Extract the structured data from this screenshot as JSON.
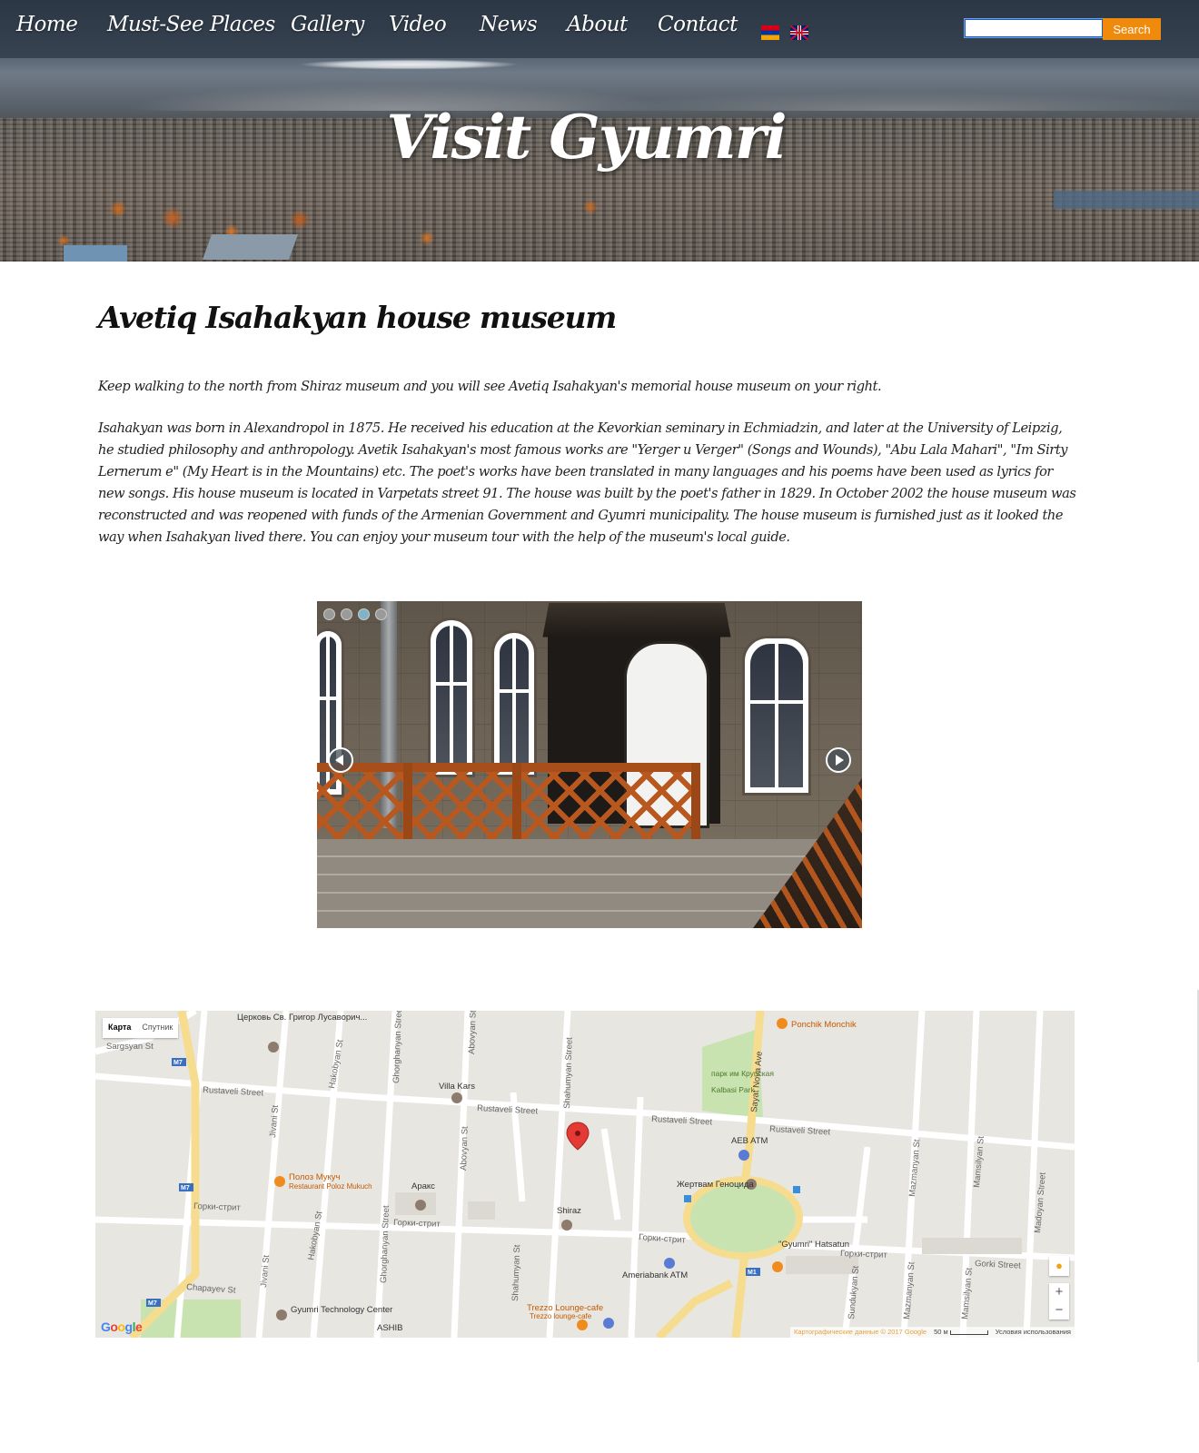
{
  "nav": {
    "items": [
      "Home",
      "Must-See Places",
      "Gallery",
      "Video",
      "News",
      "About",
      "Contact"
    ],
    "search_value": "",
    "search_button": "Search",
    "languages": [
      "Armenian",
      "English"
    ]
  },
  "hero": {
    "title": "Visit Gyumri"
  },
  "article": {
    "title": "Avetiq Isahakyan house museum",
    "paragraphs": [
      "Keep walking to the north from Shiraz museum and you will see Avetiq Isahakyan's memorial house museum on your right.",
      "Isahakyan was born in Alexandropol in 1875. He received his education at the Kevorkian seminary in Echmiadzin, and later at the University of Leipzig, he studied philosophy and anthropology. Avetik Isahakyan's most famous works are \"Yerger u Verger\" (Songs and Wounds), \"Abu Lala Mahari\", \"Im Sirty Lernerum e\" (My Heart is in the Mountains) etc. The poet's works have been translated in many languages and his poems have been used as lyrics for new songs. His house museum is located in Varpetats street 91. The house was built by the poet's father in 1829. In October 2002 the house museum was reconstructed and was reopened with funds of the Armenian Government and Gyumri municipality. The house museum is furnished just as it looked the way when Isahakyan lived there. You can enjoy your museum tour with the help of the museum's local guide."
    ]
  },
  "slideshow": {
    "slide_count": 4,
    "active_slide": 3
  },
  "map": {
    "type_buttons": [
      "Карта",
      "Спутник"
    ],
    "streets": [
      "Sargsyan St",
      "Rustaveli Street",
      "Rustaveli Street",
      "Rustaveli Street",
      "Rustaveli Street",
      "Горки-стрит",
      "Горки-стрит",
      "Горки-стрит",
      "Горки-стрит",
      "Gorki Street",
      "Chapayev St",
      "Jivani St",
      "Jivani St",
      "Hakobyan St",
      "Hakobyan St",
      "Ghorghanyan Street",
      "Ghorghanyan Street",
      "Abovyan St",
      "Abovyan St",
      "Shahumyan Street",
      "Shahumyan St",
      "Sayat Nova Ave",
      "Sundukyan St",
      "Mazmanyan St",
      "Mazmanyan St",
      "Mamsilyan St",
      "Mamsilyan St",
      "Madoyan Street"
    ],
    "places": [
      "Церковь Св. Григор Лусаворич...",
      "Villa Kars",
      "Полоз Мукуч",
      "Restaurant Poloz Mukuch",
      "Аракс",
      "Shiraz",
      "AEB ATM",
      "Жертвам Геноцида",
      "\"Gyumri\" Hatsatun",
      "Ameriabank ATM",
      "Trezzo Lounge-cafe",
      "Trezzo lounge-cafe",
      "Gyumri Technology Center",
      "ASHIB",
      "Ponchik Monchik",
      "парк им Крупская",
      "Kalbasi Park"
    ],
    "road_badges": [
      "M7",
      "M7",
      "M7",
      "M1"
    ],
    "zoom_in": "+",
    "zoom_out": "−",
    "google": "Google",
    "footer": [
      "Картографические данные © 2017 Google",
      "50 м",
      "Условия использования"
    ]
  }
}
